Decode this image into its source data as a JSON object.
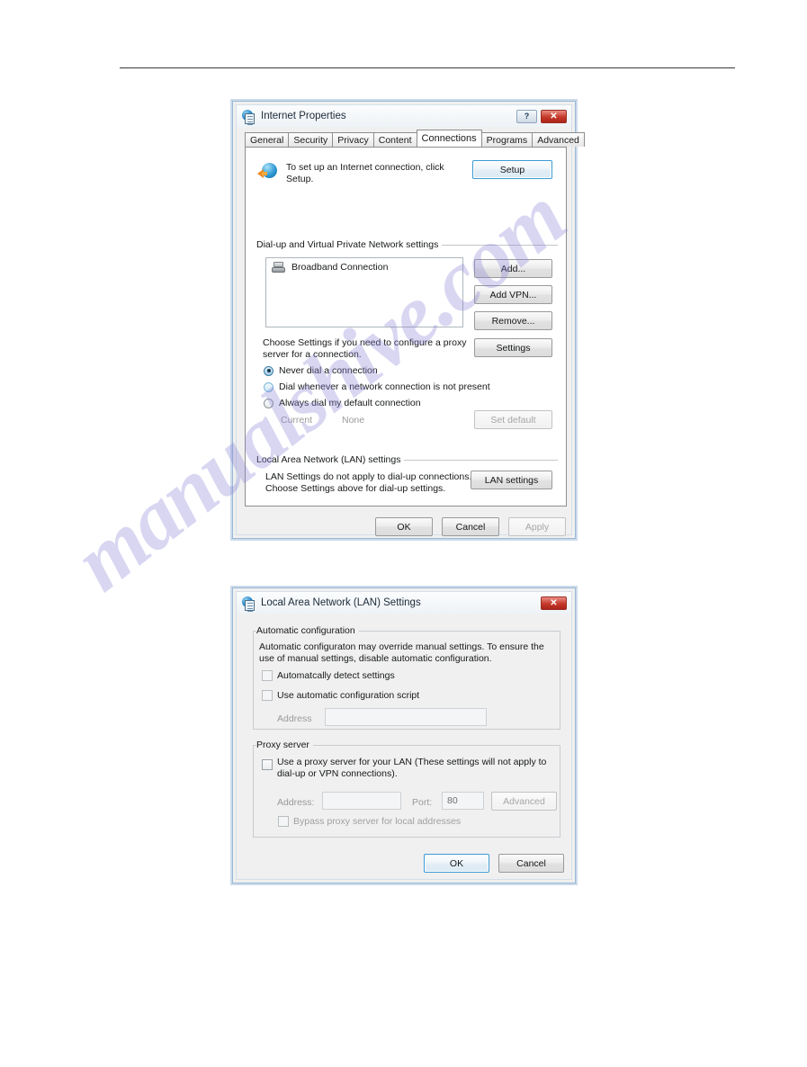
{
  "page": {
    "watermark": "manualshive.com"
  },
  "internet_properties": {
    "title": "Internet Properties",
    "icon": "internet-explorer-icon",
    "titlebar_buttons": {
      "help": "?",
      "close": "✕"
    },
    "tabs": [
      {
        "label": "General",
        "active": false
      },
      {
        "label": "Security",
        "active": false
      },
      {
        "label": "Privacy",
        "active": false
      },
      {
        "label": "Content",
        "active": false
      },
      {
        "label": "Connections",
        "active": true
      },
      {
        "label": "Programs",
        "active": false
      },
      {
        "label": "Advanced",
        "active": false
      }
    ],
    "setup": {
      "text": "To set up an Internet connection, click\nSetup.",
      "text_line1": "To set up an Internet connection, click",
      "text_line2": "Setup.",
      "button": "Setup"
    },
    "dialup_group": {
      "legend": "Dial-up and Virtual Private Network settings",
      "entries": [
        "Broadband Connection"
      ],
      "buttons": {
        "add": "Add...",
        "add_vpn": "Add VPN...",
        "remove": "Remove...",
        "settings": "Settings"
      }
    },
    "proxy_hint": {
      "line1": "Choose Settings if you need to configure a proxy",
      "line2": "server for a connection."
    },
    "dial_options": [
      {
        "label": "Never dial a connection",
        "state": "selected"
      },
      {
        "label": "Dial whenever a network connection is not present",
        "state": "hover"
      },
      {
        "label": "Always dial my default connection",
        "state": "normal"
      }
    ],
    "current_row": {
      "label": "Current",
      "value": "None",
      "button": "Set default"
    },
    "lan_group": {
      "legend": "Local Area Network (LAN) settings",
      "line1": "LAN Settings do not apply to dial-up connections.",
      "line2": "Choose Settings above for dial-up settings.",
      "button": "LAN settings"
    },
    "footer_buttons": {
      "ok": "OK",
      "cancel": "Cancel",
      "apply": "Apply"
    }
  },
  "lan_settings": {
    "title": "Local Area Network (LAN) Settings",
    "icon": "internet-explorer-icon",
    "titlebar_buttons": {
      "close": "✕"
    },
    "automatic_configuration": {
      "legend": "Automatic configuration",
      "line1": "Automatic configuraton may override manual settings.  To ensure the",
      "line2": "use of manual settings, disable automatic configuration.",
      "auto_detect": {
        "label": "Automatcally detect settings",
        "checked": false
      },
      "use_script": {
        "label": "Use automatic configuration script",
        "checked": false
      },
      "address": {
        "label": "Address",
        "value": "",
        "enabled": false
      }
    },
    "proxy_server": {
      "legend": "Proxy server",
      "use_proxy": {
        "line1": "Use a proxy server for your LAN (These settings will not apply to",
        "line2": "dial-up or VPN connections).",
        "checked": false
      },
      "address": {
        "label": "Address:",
        "value": ""
      },
      "port": {
        "label": "Port:",
        "value": "80"
      },
      "advanced_button": "Advanced",
      "bypass": {
        "label": "Bypass proxy server for local addresses",
        "checked": false
      }
    },
    "footer_buttons": {
      "ok": "OK",
      "cancel": "Cancel"
    }
  },
  "colors": {
    "window_face": "#f0f0f0",
    "window_border": "#9bb8d4",
    "close_red": "#c6392b",
    "focus_blue": "#3c9ad4",
    "watermark_purple": "#8a84d6"
  }
}
